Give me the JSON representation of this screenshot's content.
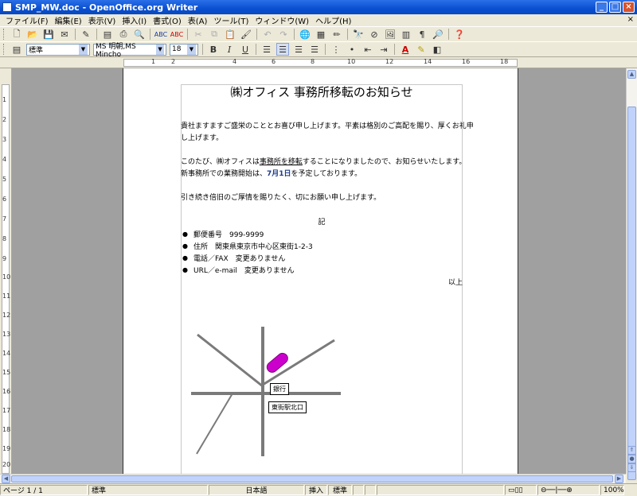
{
  "window": {
    "title": "SMP_MW.doc - OpenOffice.org Writer",
    "minimize": "_",
    "maximize": "□",
    "close": "×"
  },
  "menubar": {
    "items": [
      "ファイル(F)",
      "編集(E)",
      "表示(V)",
      "挿入(I)",
      "書式(O)",
      "表(A)",
      "ツール(T)",
      "ウィンドウ(W)",
      "ヘルプ(H)"
    ],
    "close_doc": "×"
  },
  "format_toolbar": {
    "style": "標準",
    "font": "MS 明朝,MS Mincho",
    "size": "18"
  },
  "ruler": {
    "h_marks": [
      "1",
      "2",
      "4",
      "6",
      "8",
      "10",
      "12",
      "14",
      "16",
      "18"
    ],
    "v_marks": [
      "1",
      "2",
      "3",
      "4",
      "5",
      "6",
      "7",
      "8",
      "9",
      "10",
      "11",
      "12",
      "13",
      "14",
      "15",
      "16",
      "17",
      "18",
      "19",
      "20"
    ]
  },
  "document": {
    "title": "㈱オフィス 事務所移転のお知らせ",
    "para1_line1": "貴社ますますご盛栄のこととお喜び申し上げます。平素は格別のご高配を賜り、厚くお礼申",
    "para1_line2": "し上げます。",
    "para2_a": "このたび、㈱オフィスは",
    "para2_underline": "事務所を移転",
    "para2_b": "することになりましたので、お知らせいたします。",
    "para3_a": "新事務所での業務開始は、",
    "para3_date": "7月1日",
    "para3_b": "を予定しております。",
    "para4": "引き続き倍旧のご厚情を賜りたく、切にお願い申し上げます。",
    "ki": "記",
    "bullets": [
      "郵便番号　999-9999",
      "住所　関東県東京市中心区東街1-2-3",
      "電話／FAX　変更ありません",
      "URL／e-mail　変更ありません"
    ],
    "ijou": "以上",
    "map_labels": {
      "bank": "銀行",
      "station": "東街駅北口"
    }
  },
  "statusbar": {
    "page": "ページ 1 / 1",
    "style": "標準",
    "language": "日本語",
    "insert": "挿入",
    "selection": "標準",
    "zoom": "100%"
  },
  "colors": {
    "titlebar": "#0a4fd0",
    "accent_text": "#1a3a8a",
    "marker": "#cc00cc"
  }
}
